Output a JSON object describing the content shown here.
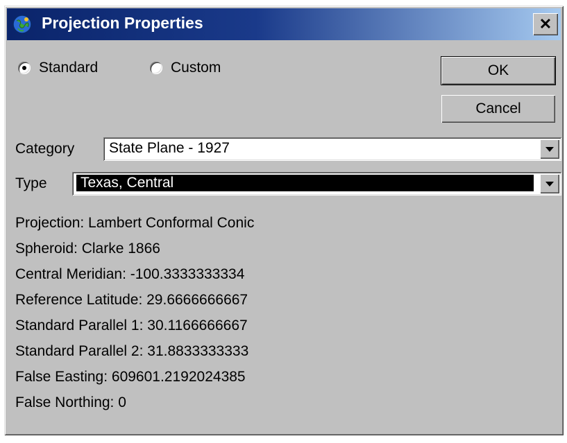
{
  "window": {
    "title": "Projection Properties"
  },
  "mode": {
    "standard_label": "Standard",
    "custom_label": "Custom",
    "selected": "Standard"
  },
  "buttons": {
    "ok_label": "OK",
    "cancel_label": "Cancel"
  },
  "category": {
    "label": "Category",
    "value": "State Plane - 1927"
  },
  "type": {
    "label": "Type",
    "value": "Texas, Central"
  },
  "properties": [
    "Projection: Lambert Conformal Conic",
    "Spheroid: Clarke 1866",
    "Central Meridian: -100.3333333334",
    "Reference Latitude: 29.6666666667",
    "Standard Parallel 1: 30.1166666667",
    "Standard Parallel 2: 31.8833333333",
    "False Easting: 609601.2192024385",
    "False Northing: 0"
  ],
  "colors": {
    "title_start": "#0a246a",
    "title_end": "#a6caf0",
    "face": "#c0c0c0"
  },
  "icons": {
    "title": "globe-icon",
    "close": "close-icon",
    "dropdown": "chevron-down-icon"
  }
}
